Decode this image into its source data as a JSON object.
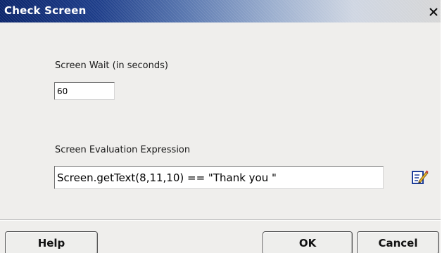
{
  "window": {
    "title": "Check Screen",
    "close_glyph": "X",
    "close_icon": "close-icon"
  },
  "screen_wait": {
    "label": "Screen Wait (in seconds)",
    "value": "60"
  },
  "expression": {
    "label": "Screen Evaluation Expression",
    "value": "Screen.getText(8,11,10) == \"Thank you \"",
    "edit_icon": "edit-expression-icon"
  },
  "buttons": {
    "help": "Help",
    "ok": "OK",
    "cancel": "Cancel"
  },
  "colors": {
    "titlebar_start": "#0a246a",
    "titlebar_end": "#d6d6d6",
    "dialog_bg": "#efeeec"
  }
}
